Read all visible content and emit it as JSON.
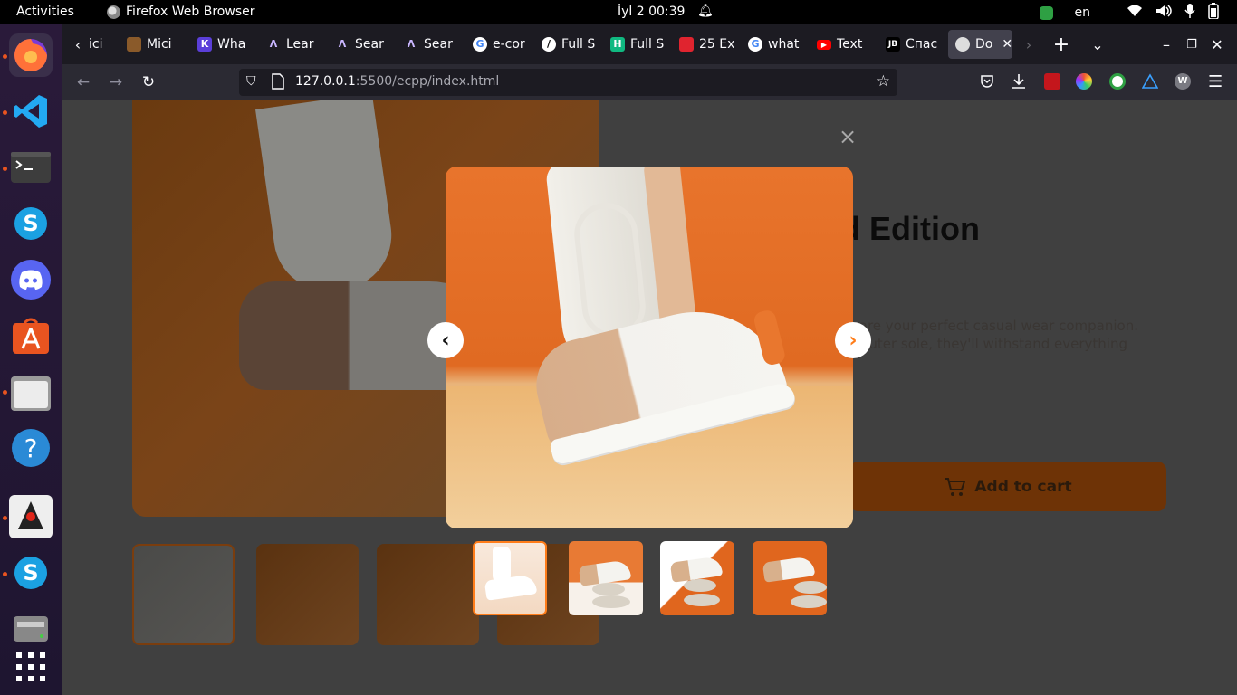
{
  "topbar": {
    "activities": "Activities",
    "app_name": "Firefox Web Browser",
    "clock": "İyl 2  00:39",
    "language": "en"
  },
  "dock": {
    "items": [
      "firefox",
      "vscode",
      "terminal",
      "skype",
      "discord",
      "software-center",
      "files",
      "help",
      "java",
      "skype",
      "disk",
      "app-grid"
    ]
  },
  "tabs": [
    {
      "label": "ici",
      "favicon": "generic"
    },
    {
      "label": "Mici",
      "favicon": "brown"
    },
    {
      "label": "Wha",
      "favicon": "K"
    },
    {
      "label": "Lear",
      "favicon": "A"
    },
    {
      "label": "Sear",
      "favicon": "A"
    },
    {
      "label": "Sear",
      "favicon": "A"
    },
    {
      "label": "e-cor",
      "favicon": "G"
    },
    {
      "label": "Full S",
      "favicon": "leaf"
    },
    {
      "label": "Full S",
      "favicon": "H"
    },
    {
      "label": "25 Ex",
      "favicon": "red"
    },
    {
      "label": "what",
      "favicon": "G"
    },
    {
      "label": "Text",
      "favicon": "youtube"
    },
    {
      "label": "Спас",
      "favicon": "JB"
    },
    {
      "label": "Do",
      "favicon": "generic"
    }
  ],
  "navbar": {
    "url_host": "127.0.0.1",
    "url_rest": ":5500/ecpp/index.html"
  },
  "page": {
    "title_fragment": "ed Edition",
    "desc_line1": "rs are your perfect casual wear companion.",
    "desc_line2": "er outer sole, they'll withstand everything",
    "add_to_cart": "Add to cart",
    "close_symbol": "×"
  },
  "lightbox": {
    "prev_symbol": "‹",
    "next_symbol": "›",
    "active_thumb": 1,
    "thumb_count": 4
  },
  "colors": {
    "accent_orange": "#ff7d1a",
    "product_bg": "#e8742c",
    "tab_active": "#42414d"
  }
}
